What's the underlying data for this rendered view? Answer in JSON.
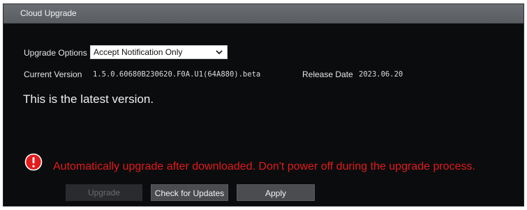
{
  "window": {
    "title": "Cloud Upgrade"
  },
  "upgrade_options": {
    "label": "Upgrade Options",
    "selected": "Accept Notification Only"
  },
  "current_version": {
    "label": "Current Version",
    "value": "1.5.0.60680B230620.F0A.U1(64A880).beta"
  },
  "release_date": {
    "label": "Release Date",
    "value": "2023.06.20"
  },
  "status": {
    "message": "This is the latest version."
  },
  "warning": {
    "icon": "alert-circle-icon",
    "text": "Automatically upgrade after downloaded. Don't power off during the upgrade process.",
    "color": "#e21b1b"
  },
  "buttons": {
    "upgrade": "Upgrade",
    "check": "Check for Updates",
    "apply": "Apply"
  },
  "colors": {
    "background": "#0b0c0e",
    "titlebar": "#5f6267",
    "button": "#4a4c50",
    "button_disabled": "#2a2b2e"
  }
}
